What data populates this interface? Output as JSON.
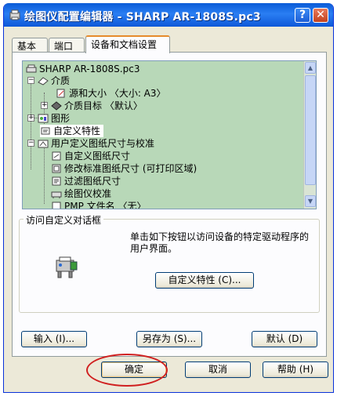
{
  "window": {
    "title": "绘图仪配置编辑器 - SHARP AR-1808S.pc3",
    "help_label": "?",
    "close_label": "✕"
  },
  "tabs": [
    {
      "label": "基本"
    },
    {
      "label": "端口"
    },
    {
      "label": "设备和文档设置"
    }
  ],
  "tree": {
    "root": "SHARP AR-1808S.pc3",
    "items": [
      {
        "label": "介质"
      },
      {
        "label": "源和大小 〈大小: A3〉"
      },
      {
        "label": "介质目标 〈默认〉"
      },
      {
        "label": "图形"
      },
      {
        "label": "自定义特性"
      },
      {
        "label": "用户定义图纸尺寸与校准"
      },
      {
        "label": "自定义图纸尺寸"
      },
      {
        "label": "修改标准图纸尺寸 (可打印区域)"
      },
      {
        "label": "过滤图纸尺寸"
      },
      {
        "label": "绘图仪校准"
      },
      {
        "label": "PMP 文件名 〈无〉"
      }
    ]
  },
  "group": {
    "title": "访问自定义对话框",
    "description": "单击如下按钮以访问设备的特定驱动程序的用户界面。",
    "custom_button": "自定义特性 (C)..."
  },
  "buttons": {
    "import": "输入 (I)...",
    "save_as": "另存为 (S)...",
    "defaults": "默认 (D)",
    "ok": "确定",
    "cancel": "取消",
    "help": "帮助 (H)"
  },
  "colors": {
    "titlebar": "#0a5bd7",
    "tree_background": "#b8d8b8",
    "highlight_ring": "#d02020"
  }
}
